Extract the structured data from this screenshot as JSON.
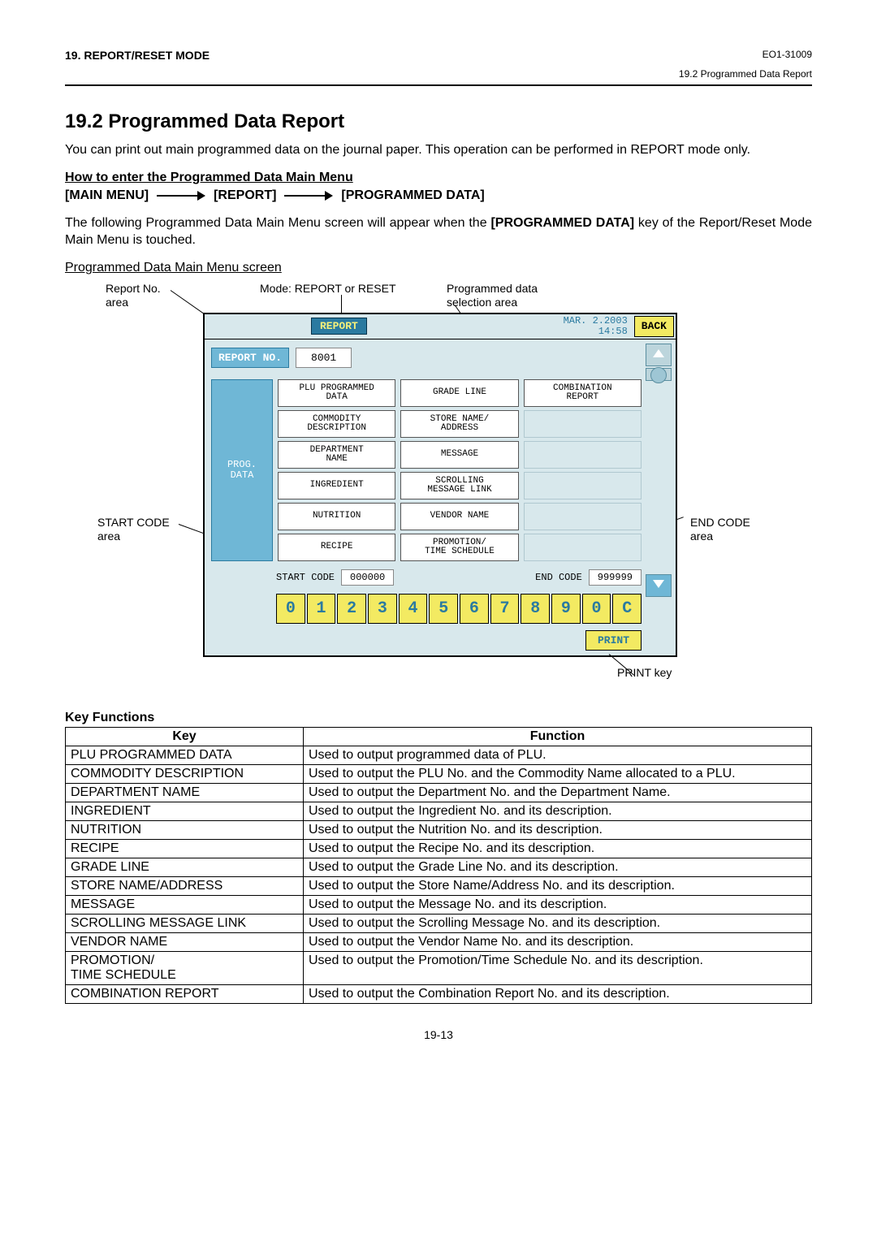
{
  "header": {
    "left": "19. REPORT/RESET MODE",
    "right": "EO1-31009",
    "sub": "19.2 Programmed Data Report"
  },
  "section": {
    "title": "19.2   Programmed Data Report",
    "intro": "You can print out main programmed data on the journal paper.  This operation can be performed in REPORT mode only.",
    "howto": "How to enter the Programmed Data Main Menu",
    "nav1": "[MAIN MENU]",
    "nav2": "[REPORT]",
    "nav3": "[PROGRAMMED DATA]",
    "explain": "The following Programmed Data Main Menu screen will appear when the ",
    "explain_bold": "[PROGRAMMED DATA]",
    "explain2": " key of the Report/Reset Mode Main Menu is touched.",
    "screen_caption": "Programmed Data Main Menu screen"
  },
  "callouts": {
    "reportno": "Report No.\narea",
    "mode": "Mode: REPORT or RESET",
    "progdata": "Programmed data\nselection area",
    "startcode": "START CODE\narea",
    "endcode": "END CODE\narea",
    "printkey": "PRINT key"
  },
  "screen": {
    "mode": "REPORT",
    "date": "MAR. 2.2003",
    "time": "14:58",
    "back": "BACK",
    "reportno_label": "REPORT NO.",
    "reportno_value": "8001",
    "side_label": "PROG.\nDATA",
    "cols": [
      [
        "PLU PROGRAMMED\nDATA",
        "COMMODITY\nDESCRIPTION",
        "DEPARTMENT\nNAME",
        "INGREDIENT",
        "NUTRITION",
        "RECIPE"
      ],
      [
        "GRADE LINE",
        "STORE NAME/\nADDRESS",
        "MESSAGE",
        "SCROLLING\nMESSAGE LINK",
        "VENDOR NAME",
        "PROMOTION/\nTIME SCHEDULE"
      ],
      [
        "COMBINATION\nREPORT",
        "",
        "",
        "",
        "",
        ""
      ]
    ],
    "startcode_label": "START CODE",
    "startcode_value": "000000",
    "endcode_label": "END CODE",
    "endcode_value": "999999",
    "keys": [
      "0",
      "1",
      "2",
      "3",
      "4",
      "5",
      "6",
      "7",
      "8",
      "9",
      "0",
      "C"
    ],
    "print": "PRINT"
  },
  "kf": {
    "title": "Key Functions",
    "head_key": "Key",
    "head_fn": "Function",
    "rows": [
      [
        "PLU PROGRAMMED DATA",
        "Used to output programmed data of PLU."
      ],
      [
        "COMMODITY DESCRIPTION",
        "Used to output the PLU No. and the Commodity Name allocated to a PLU."
      ],
      [
        "DEPARTMENT NAME",
        "Used to output the Department No. and the Department Name."
      ],
      [
        "INGREDIENT",
        "Used to output the Ingredient No. and its description."
      ],
      [
        "NUTRITION",
        "Used to output the Nutrition No. and its description."
      ],
      [
        "RECIPE",
        "Used to output the Recipe No. and its description."
      ],
      [
        "GRADE LINE",
        "Used to output the Grade Line No. and its description."
      ],
      [
        "STORE NAME/ADDRESS",
        "Used to output the Store Name/Address No. and its description."
      ],
      [
        "MESSAGE",
        "Used to output the Message No. and its description."
      ],
      [
        "SCROLLING MESSAGE LINK",
        "Used to output the Scrolling Message No. and its description."
      ],
      [
        "VENDOR NAME",
        "Used to output the Vendor Name No. and its description."
      ],
      [
        "PROMOTION/\nTIME SCHEDULE",
        "Used to output the Promotion/Time Schedule No. and its description."
      ],
      [
        "COMBINATION REPORT",
        "Used to output the Combination Report No. and its description."
      ]
    ]
  },
  "pagenum": "19-13"
}
